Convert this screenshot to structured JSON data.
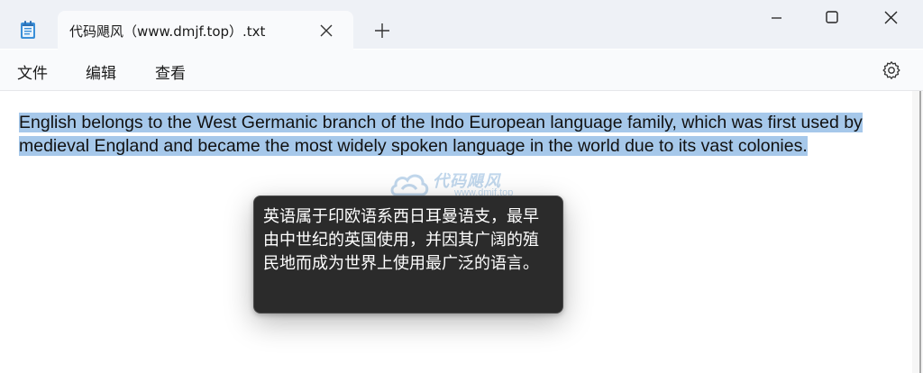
{
  "window": {
    "tab_title": "代码飓风（www.dmjf.top）.txt",
    "icons": {
      "app": "notepad-icon",
      "tab_close": "close-icon",
      "new_tab": "plus-icon",
      "minimize": "minimize-icon",
      "maximize": "maximize-icon",
      "close": "close-icon"
    }
  },
  "menu": {
    "file": "文件",
    "edit": "编辑",
    "view": "查看",
    "settings_icon": "gear-icon"
  },
  "editor": {
    "content": "English belongs to the West Germanic branch of the Indo European language family, which was first used by medieval England and became the most widely spoken language in the world due to its vast colonies.",
    "selection_color": "#a6c8ea"
  },
  "watermark": {
    "title": "代码飓风",
    "url": "www.dmjf.top"
  },
  "popup": {
    "text": "英语属于印欧语系西日耳曼语支，最早由中世纪的英国使用，并因其广阔的殖民地而成为世界上使用最广泛的语言。"
  },
  "colors": {
    "titlebar": "#eef1f6",
    "popup_bg": "#2b2b2b"
  }
}
